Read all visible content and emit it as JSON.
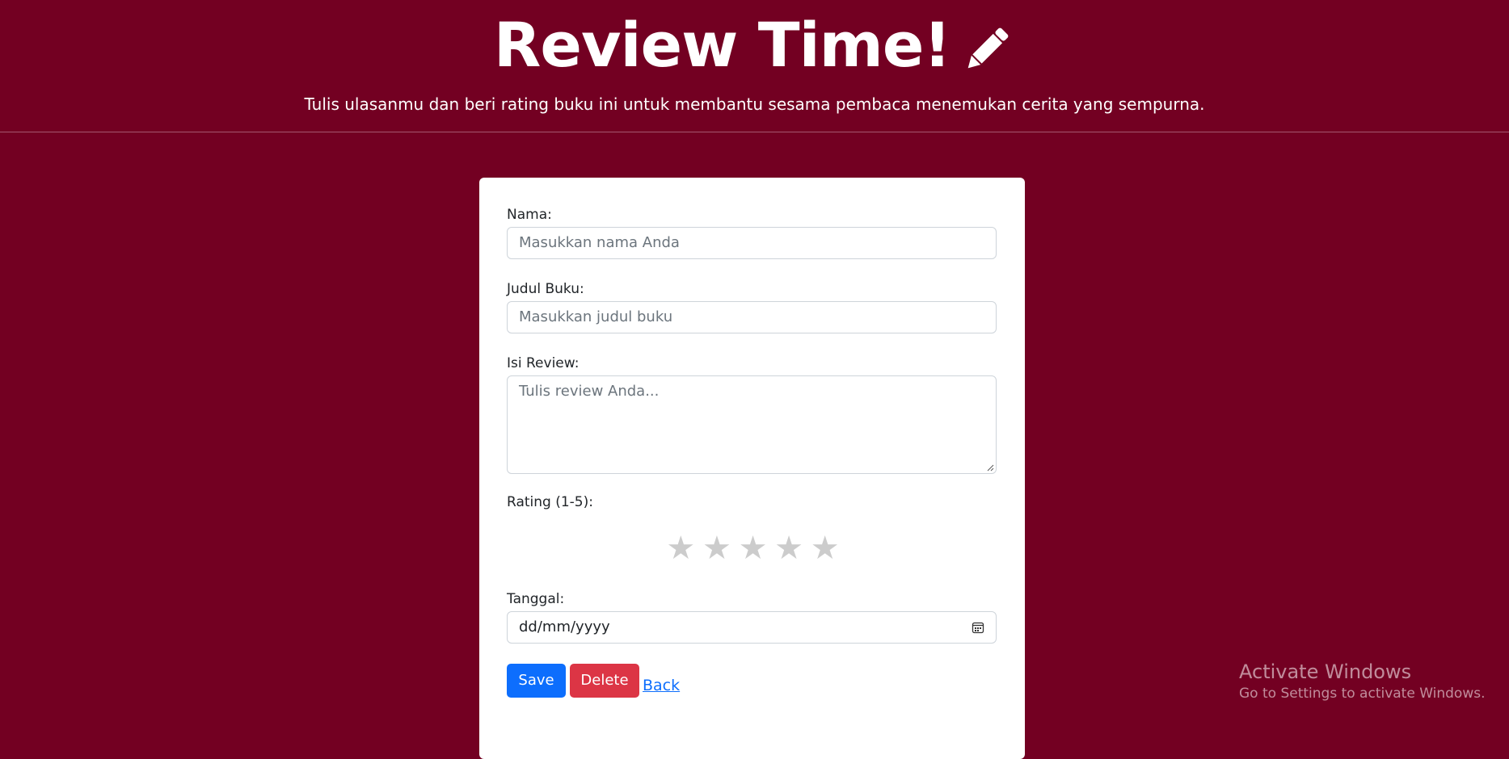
{
  "header": {
    "title": "Review Time!",
    "subtitle": "Tulis ulasanmu dan beri rating buku ini untuk membantu sesama pembaca menemukan cerita yang sempurna."
  },
  "form": {
    "name_label": "Nama:",
    "name_placeholder": "Masukkan nama Anda",
    "book_label": "Judul Buku:",
    "book_placeholder": "Masukkan judul buku",
    "review_label": "Isi Review:",
    "review_placeholder": "Tulis review Anda...",
    "rating_label": "Rating (1-5):",
    "rating_value": 0,
    "rating_max": 5,
    "date_label": "Tanggal:",
    "date_value": "dd/mm/yyyy"
  },
  "actions": {
    "save_label": "Save",
    "delete_label": "Delete",
    "back_label": "Back"
  },
  "watermark": {
    "title": "Activate Windows",
    "subtitle": "Go to Settings to activate Windows."
  },
  "colors": {
    "background": "#730022",
    "save_button": "#0d6efd",
    "delete_button": "#dc3545",
    "star_empty": "#cccccc"
  },
  "icons": [
    "pencil-icon",
    "calendar-icon",
    "star-icon"
  ]
}
